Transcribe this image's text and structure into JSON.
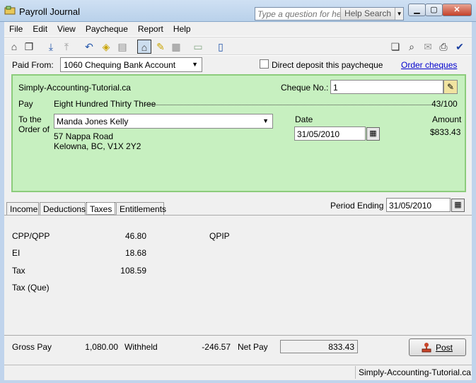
{
  "window": {
    "title": "Payroll Journal"
  },
  "help": {
    "placeholder": "Type a question for help",
    "search_label": "Help Search"
  },
  "menu": [
    "File",
    "Edit",
    "View",
    "Paycheque",
    "Report",
    "Help"
  ],
  "header": {
    "paid_from_label": "Paid From:",
    "account": "1060 Chequing Bank Account",
    "direct_deposit_label": "Direct deposit this paycheque",
    "order_cheques_link": "Order cheques"
  },
  "cheque": {
    "company": "Simply-Accounting-Tutorial.ca",
    "cheque_no_label": "Cheque No.:",
    "cheque_no": "1",
    "pay_label": "Pay",
    "amount_words": "Eight Hundred Thirty Three",
    "cents": "43/100",
    "to_order_line1": "To the",
    "to_order_line2": "Order of",
    "payee": "Manda Jones Kelly",
    "address_line1": "57 Nappa Road",
    "address_line2": "Kelowna, BC, V1X 2Y2",
    "date_label": "Date",
    "date": "31/05/2010",
    "amount_label": "Amount",
    "amount": "$833.43"
  },
  "tabs": [
    "Income",
    "Deductions",
    "Taxes",
    "Entitlements"
  ],
  "period": {
    "label": "Period Ending",
    "value": "31/05/2010"
  },
  "taxes": {
    "cpp_label": "CPP/QPP",
    "cpp_value": "46.80",
    "qpip_label": "QPIP",
    "ei_label": "EI",
    "ei_value": "18.68",
    "tax_label": "Tax",
    "tax_value": "108.59",
    "tax_que_label": "Tax (Que)"
  },
  "footer": {
    "gross_label": "Gross Pay",
    "gross_value": "1,080.00",
    "withheld_label": "Withheld",
    "withheld_value": "-246.57",
    "net_label": "Net Pay",
    "net_value": "833.43",
    "post_label": "Post"
  },
  "status": {
    "text": "Simply-Accounting-Tutorial.ca"
  },
  "colors": {
    "cheque_bg": "#c7f0c0",
    "cheque_border": "#8ccc7c",
    "link": "#0000cc"
  }
}
